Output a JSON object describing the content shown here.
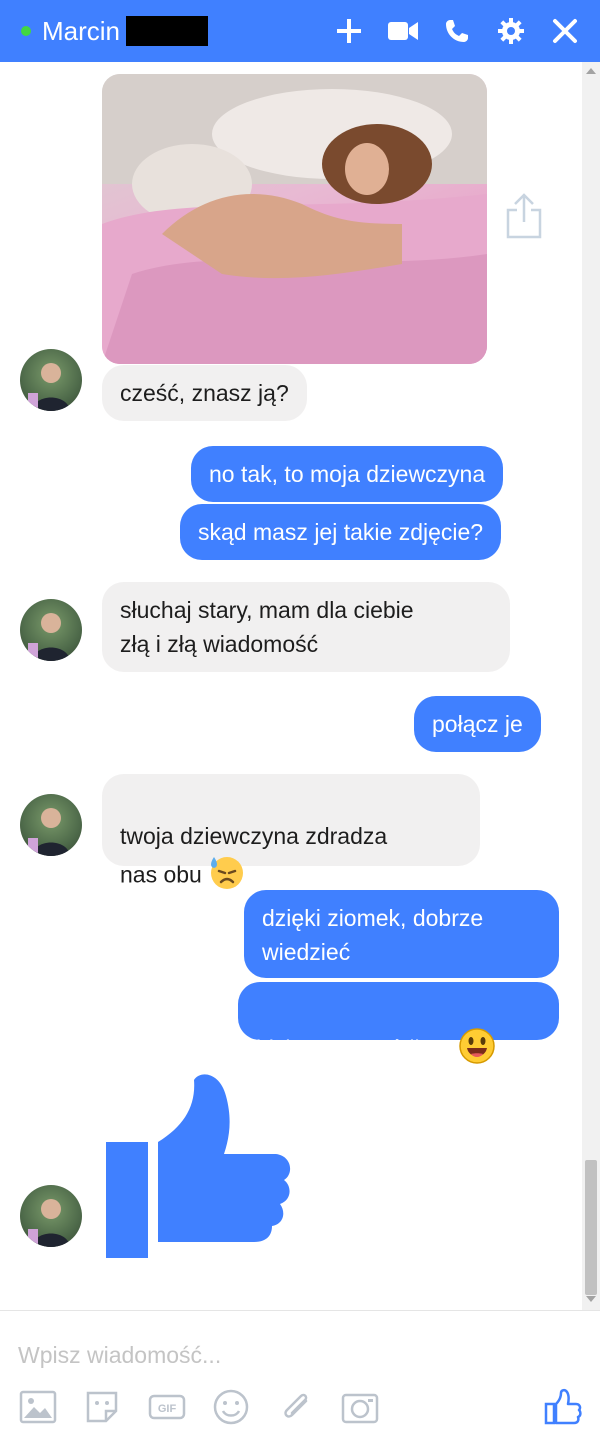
{
  "header": {
    "contact_name": "Marcin",
    "icons": [
      "add-icon",
      "video-call-icon",
      "phone-icon",
      "settings-icon",
      "close-icon"
    ],
    "accent_color": "#4080ff",
    "online_color": "#42d742"
  },
  "messages": [
    {
      "from": "contact",
      "type": "image"
    },
    {
      "from": "contact",
      "text": "cześć, znasz ją?"
    },
    {
      "from": "me",
      "text": "no tak, to moja dziewczyna"
    },
    {
      "from": "me",
      "text": "skąd masz jej takie zdjęcie?"
    },
    {
      "from": "contact",
      "text": "słuchaj stary, mam dla ciebie\nzłą i złą wiadomość"
    },
    {
      "from": "me",
      "text": "połącz je"
    },
    {
      "from": "contact",
      "text": "twoja dziewczyna zdradza\nnas obu",
      "emoji": "downcast-sweat-face"
    },
    {
      "from": "me",
      "text": "dzięki ziomek, dobrze\nwiedzieć"
    },
    {
      "from": "me",
      "text": "idziemy na wódkę?",
      "emoji": "smiling-face"
    },
    {
      "from": "contact",
      "type": "like-sticker"
    }
  ],
  "composer": {
    "placeholder": "Wpisz wiadomość...",
    "tools": [
      "image-icon",
      "sticker-icon",
      "gif-icon",
      "emoji-icon",
      "attachment-icon",
      "camera-icon",
      "like-icon"
    ]
  }
}
